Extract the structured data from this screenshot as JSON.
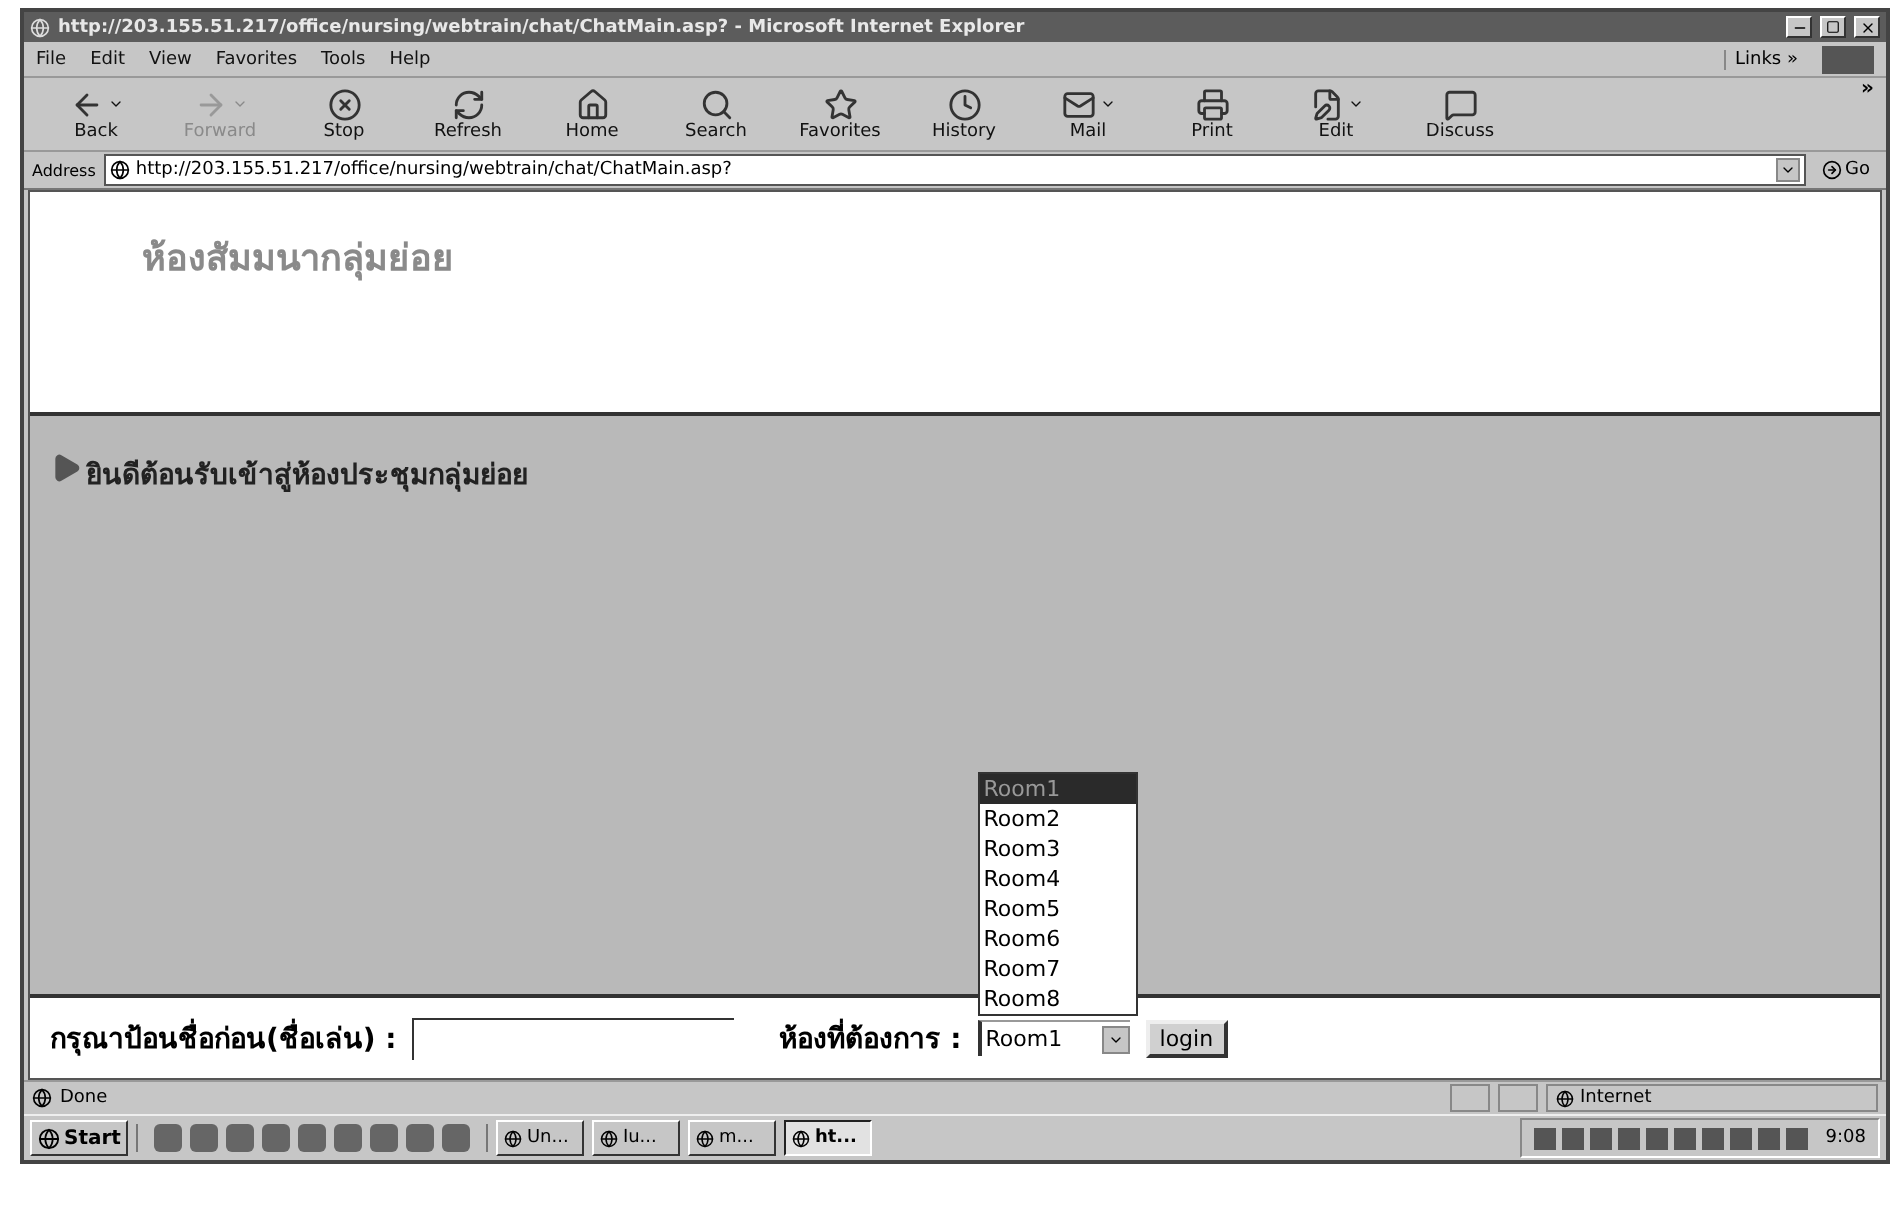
{
  "window": {
    "title": "http://203.155.51.217/office/nursing/webtrain/chat/ChatMain.asp? - Microsoft Internet Explorer"
  },
  "menu": [
    "File",
    "Edit",
    "View",
    "Favorites",
    "Tools",
    "Help"
  ],
  "links": {
    "label": "Links",
    "chevron": "»"
  },
  "toolbar": [
    {
      "label": "Back",
      "kind": "back",
      "disabled": false,
      "has_menu": true
    },
    {
      "label": "Forward",
      "kind": "forward",
      "disabled": true,
      "has_menu": true
    },
    {
      "label": "Stop",
      "kind": "stop",
      "disabled": false,
      "has_menu": false
    },
    {
      "label": "Refresh",
      "kind": "refresh",
      "disabled": false,
      "has_menu": false
    },
    {
      "label": "Home",
      "kind": "home",
      "disabled": false,
      "has_menu": false
    },
    {
      "label": "Search",
      "kind": "search",
      "disabled": false,
      "has_menu": false
    },
    {
      "label": "Favorites",
      "kind": "favorites",
      "disabled": false,
      "has_menu": false
    },
    {
      "label": "History",
      "kind": "history",
      "disabled": false,
      "has_menu": false
    },
    {
      "label": "Mail",
      "kind": "mail",
      "disabled": false,
      "has_menu": true
    },
    {
      "label": "Print",
      "kind": "print",
      "disabled": false,
      "has_menu": false
    },
    {
      "label": "Edit",
      "kind": "edit",
      "disabled": false,
      "has_menu": true
    },
    {
      "label": "Discuss",
      "kind": "discuss",
      "disabled": false,
      "has_menu": false
    }
  ],
  "toolbar_more": "»",
  "address": {
    "label": "Address",
    "value": "http://203.155.51.217/office/nursing/webtrain/chat/ChatMain.asp?",
    "go": "Go"
  },
  "page": {
    "heading": "ห้องสัมมนากลุ่มย่อย",
    "welcome": "ยินดีต้อนรับเข้าสู่ห้องประชุมกลุ่มย่อย",
    "nickname_label": "กรุณาป้อนชื่อก่อน(ชื่อเล่น) :",
    "room_label": "ห้องที่ต้องการ :",
    "room_value": "Room1",
    "login": "login",
    "room_options": [
      {
        "label": "Room1",
        "selected": true
      },
      {
        "label": "Room2",
        "selected": false
      },
      {
        "label": "Room3",
        "selected": false
      },
      {
        "label": "Room4",
        "selected": false
      },
      {
        "label": "Room5",
        "selected": false
      },
      {
        "label": "Room6",
        "selected": false
      },
      {
        "label": "Room7",
        "selected": false
      },
      {
        "label": "Room8",
        "selected": false
      }
    ]
  },
  "status_bar": {
    "text": "Done",
    "zone": "Internet"
  },
  "taskbar": {
    "start": "Start",
    "tasks": [
      {
        "label": "Un...",
        "selected": false
      },
      {
        "label": "Iu...",
        "selected": false
      },
      {
        "label": "m...",
        "selected": false
      },
      {
        "label": "ht...",
        "selected": true
      }
    ],
    "clock": "9:08"
  }
}
